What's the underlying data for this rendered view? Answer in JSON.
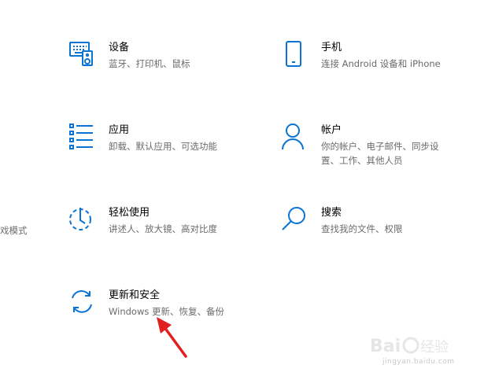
{
  "accent_color": "#0a74d4",
  "tiles": [
    {
      "id": "devices",
      "icon": "keyboard-speaker-icon",
      "title": "设备",
      "desc": "蓝牙、打印机、鼠标"
    },
    {
      "id": "phone",
      "icon": "phone-icon",
      "title": "手机",
      "desc": "连接 Android 设备和 iPhone"
    },
    {
      "id": "apps",
      "icon": "apps-list-icon",
      "title": "应用",
      "desc": "卸载、默认应用、可选功能"
    },
    {
      "id": "accounts",
      "icon": "person-icon",
      "title": "帐户",
      "desc": "你的帐户、电子邮件、同步设置、工作、其他人员"
    },
    {
      "id": "ease",
      "icon": "ease-of-access-icon",
      "title": "轻松使用",
      "desc": "讲述人、放大镜、高对比度"
    },
    {
      "id": "search",
      "icon": "search-icon",
      "title": "搜索",
      "desc": "查找我的文件、权限"
    },
    {
      "id": "update",
      "icon": "sync-icon",
      "title": "更新和安全",
      "desc": "Windows 更新、恢复、备份"
    }
  ],
  "cutoff_text": "戏模式",
  "annotation": {
    "color": "#e02020",
    "icon": "red-arrow-icon"
  },
  "watermark": {
    "logo": "Baidu经验",
    "url": "jingyan.baidu.com"
  }
}
